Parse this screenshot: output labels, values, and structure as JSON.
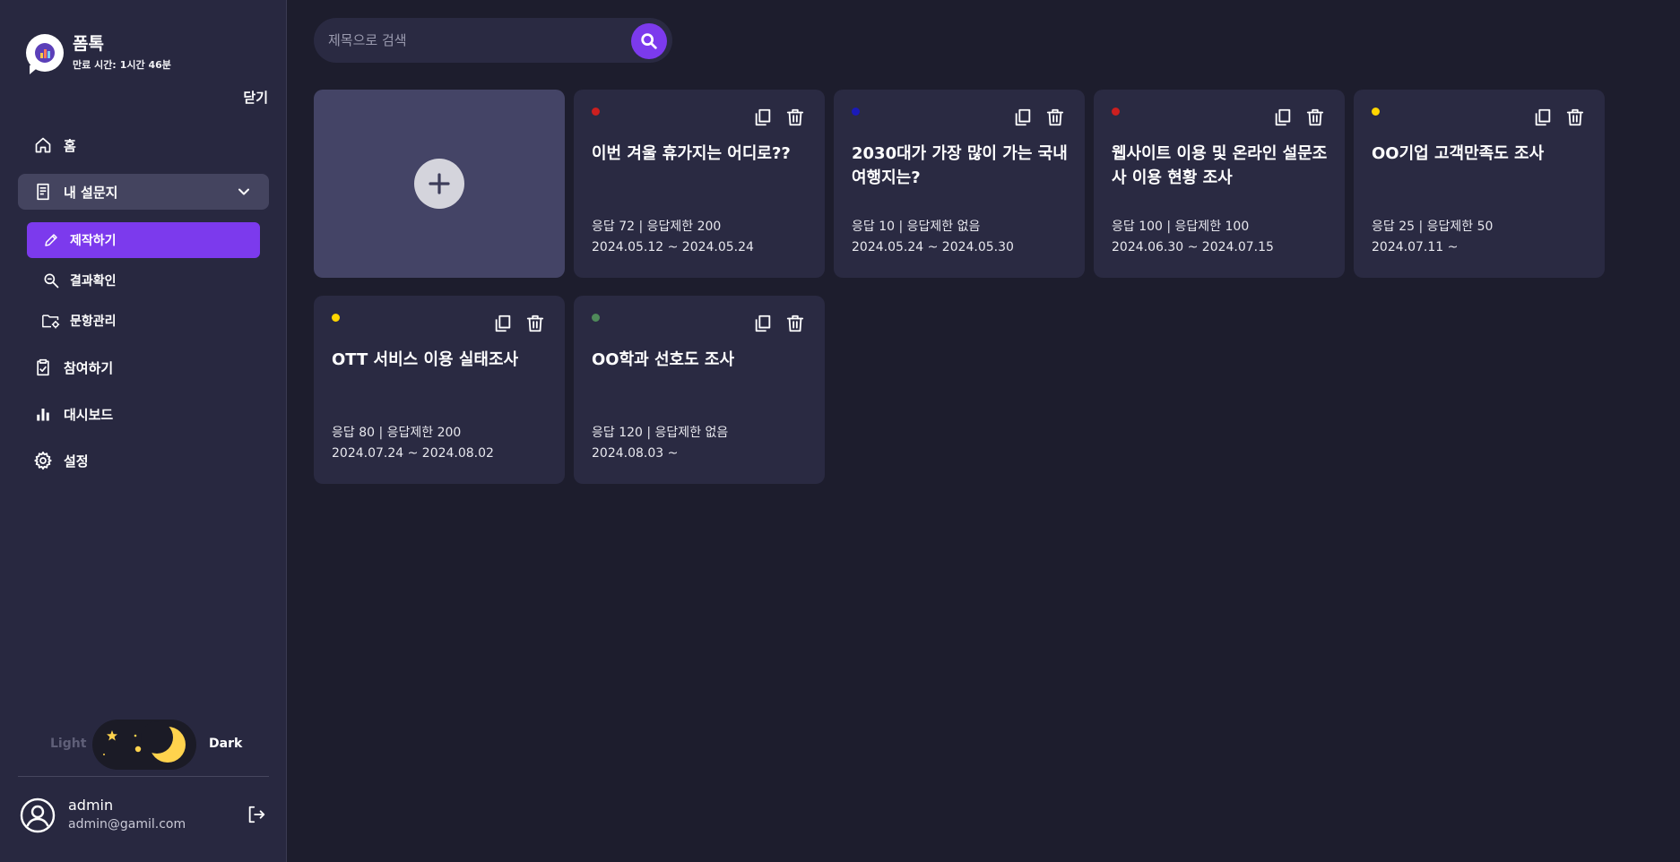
{
  "brand": {
    "name": "폼톡",
    "expire_label": "만료 시간:",
    "expire_value": "1시간 46분"
  },
  "sidebar": {
    "close_label": "닫기",
    "items": [
      {
        "label": "홈",
        "icon": "home-icon"
      },
      {
        "label": "내 설문지",
        "icon": "document-icon",
        "expanded": true
      },
      {
        "label": "참여하기",
        "icon": "clipboard-check-icon"
      },
      {
        "label": "대시보드",
        "icon": "bar-chart-icon"
      },
      {
        "label": "설정",
        "icon": "gear-icon"
      }
    ],
    "subitems": [
      {
        "label": "제작하기",
        "icon": "pencil-icon",
        "active": true
      },
      {
        "label": "결과확인",
        "icon": "zoom-search-icon"
      },
      {
        "label": "문항관리",
        "icon": "folder-settings-icon"
      }
    ]
  },
  "theme": {
    "light_label": "Light",
    "dark_label": "Dark",
    "mode": "dark"
  },
  "user": {
    "name": "admin",
    "email": "admin@gamil.com"
  },
  "search": {
    "placeholder": "제목으로 검색",
    "value": ""
  },
  "colors": {
    "accent": "#7c3aed",
    "dot_red": "#cc1f1f",
    "dot_blue": "#1a1ab8",
    "dot_yellow": "#ffd600",
    "dot_green": "#4f8a5a"
  },
  "cards": [
    {
      "title": "이번 겨울 휴가지는 어디로??",
      "stats": "응답 72 | 응답제한 200",
      "dates": "2024.05.12 ~ 2024.05.24",
      "dot": "#cc1f1f"
    },
    {
      "title": "2030대가 가장 많이 가는 국내 여행지는?",
      "stats": "응답 10 | 응답제한 없음",
      "dates": "2024.05.24 ~ 2024.05.30",
      "dot": "#1a1ab8"
    },
    {
      "title": "웹사이트 이용 및 온라인 설문조사 이용 현황 조사",
      "stats": "응답 100 | 응답제한 100",
      "dates": "2024.06.30 ~ 2024.07.15",
      "dot": "#cc1f1f"
    },
    {
      "title": "OO기업 고객만족도 조사",
      "stats": "응답 25 | 응답제한 50",
      "dates": "2024.07.11 ~",
      "dot": "#ffd600"
    },
    {
      "title": "OTT 서비스 이용 실태조사",
      "stats": "응답 80 | 응답제한 200",
      "dates": "2024.07.24 ~ 2024.08.02",
      "dot": "#ffd600"
    },
    {
      "title": "OO학과 선호도 조사",
      "stats": "응답 120 | 응답제한 없음",
      "dates": "2024.08.03 ~",
      "dot": "#4f8a5a"
    }
  ]
}
